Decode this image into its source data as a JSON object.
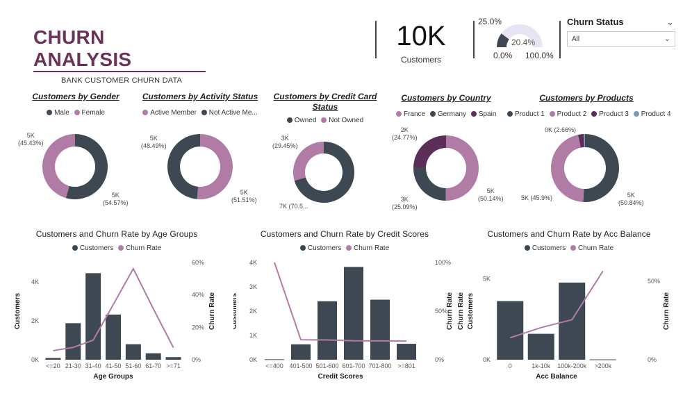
{
  "header": {
    "title": "CHURN ANALYSIS",
    "subtitle": "BANK CUSTOMER CHURN DATA"
  },
  "kpi": {
    "value": "10K",
    "label": "Customers"
  },
  "gauge": {
    "target_label": "25.0%",
    "value_label": "20.4%",
    "min_label": "0.0%",
    "max_label": "100.0%",
    "value": 0.204
  },
  "slicer": {
    "title": "Churn Status",
    "selected": "All"
  },
  "colors": {
    "dark": "#3d4853",
    "purple_light": "#b07ca6",
    "purple_dark": "#5b2e58",
    "blue_light": "#7a9ab5",
    "title": "#6a3358"
  },
  "chart_data": [
    {
      "type": "pie",
      "variant": "donut",
      "title": "Customers by Gender",
      "legend": [
        "Male",
        "Female"
      ],
      "slices": [
        {
          "name": "Male",
          "value": 54.57,
          "label": "5K\n(54.57%)",
          "color": "#3d4853"
        },
        {
          "name": "Female",
          "value": 45.43,
          "label": "5K\n(45.43%)",
          "color": "#b07ca6"
        }
      ]
    },
    {
      "type": "pie",
      "variant": "donut",
      "title": "Customers by Activity Status",
      "legend": [
        "Active Member",
        "Not Active Me..."
      ],
      "slices": [
        {
          "name": "Active Member",
          "value": 51.51,
          "label": "5K\n(51.51%)",
          "color": "#b07ca6"
        },
        {
          "name": "Not Active Member",
          "value": 48.49,
          "label": "5K\n(48.49%)",
          "color": "#3d4853"
        }
      ]
    },
    {
      "type": "pie",
      "variant": "donut",
      "title": "Customers by Credit Card Status",
      "legend": [
        "Owned",
        "Not Owned"
      ],
      "slices": [
        {
          "name": "Owned",
          "value": 70.55,
          "label": "7K (70.5...",
          "color": "#3d4853"
        },
        {
          "name": "Not Owned",
          "value": 29.45,
          "label": "3K\n(29.45%)",
          "color": "#b07ca6"
        }
      ]
    },
    {
      "type": "pie",
      "variant": "donut",
      "title": "Customers by Country",
      "legend": [
        "France",
        "Germany",
        "Spain"
      ],
      "slices": [
        {
          "name": "France",
          "value": 50.14,
          "label": "5K\n(50.14%)",
          "color": "#b07ca6"
        },
        {
          "name": "Spain",
          "value": 25.09,
          "label": "3K\n(25.09%)",
          "color": "#3d4853"
        },
        {
          "name": "Germany",
          "value": 24.77,
          "label": "2K\n(24.77%)",
          "color": "#5b2e58"
        }
      ]
    },
    {
      "type": "pie",
      "variant": "donut",
      "title": "Customers by Products",
      "legend": [
        "Product 1",
        "Product 2",
        "Product 3",
        "Product 4"
      ],
      "slices": [
        {
          "name": "Product 1",
          "value": 50.84,
          "label": "5K\n(50.84%)",
          "color": "#3d4853"
        },
        {
          "name": "Product 2",
          "value": 45.9,
          "label": "5K (45.9%)",
          "color": "#b07ca6"
        },
        {
          "name": "Product 3",
          "value": 2.66,
          "label": "",
          "color": "#5b2e58"
        },
        {
          "name": "Product 4",
          "value": 0.6,
          "label": "0K (2.66%)",
          "color": "#7a9ab5"
        }
      ]
    },
    {
      "type": "bar",
      "combo": "bar+line",
      "title": "Customers and Churn Rate by Age Groups",
      "legend": [
        "Customers",
        "Churn Rate"
      ],
      "categories": [
        "<=20",
        "21-30",
        "31-40",
        "41-50",
        "51-60",
        "61-70",
        ">=71"
      ],
      "series": [
        {
          "name": "Customers",
          "values": [
            89,
            1879,
            4451,
            2320,
            797,
            331,
            133
          ]
        },
        {
          "name": "Churn Rate",
          "values": [
            5.6,
            7.6,
            12.1,
            34.0,
            56.2,
            31.4,
            7.5
          ]
        }
      ],
      "xlabel": "Age Groups",
      "ylabel": "Customers",
      "y2label": "Churn Rate",
      "ylim": [
        0,
        5000
      ],
      "y2lim": [
        0,
        60
      ],
      "yticks": [
        "0K",
        "2K",
        "4K"
      ],
      "y2ticks": [
        "0%",
        "20%",
        "40%",
        "60%"
      ]
    },
    {
      "type": "bar",
      "combo": "bar+line",
      "title": "Customers and Churn Rate by Credit Scores",
      "legend": [
        "Customers",
        "Churn Rate"
      ],
      "categories": [
        "<=400",
        "401-500",
        "501-600",
        "601-700",
        "701-800",
        ">=801"
      ],
      "series": [
        {
          "name": "Customers",
          "values": [
            19,
            633,
            2404,
            3818,
            2471,
            655
          ]
        },
        {
          "name": "Churn Rate",
          "values": [
            100,
            20.5,
            20.4,
            19.5,
            19.4,
            19.2
          ]
        }
      ],
      "xlabel": "Credit Scores",
      "ylabel": "Customers",
      "y2label": "Churn Rate",
      "ylim": [
        0,
        4000
      ],
      "y2lim": [
        0,
        100
      ],
      "yticks": [
        "0K",
        "1K",
        "2K",
        "3K",
        "4K"
      ],
      "y2ticks": [
        "0%",
        "50%",
        "100%"
      ]
    },
    {
      "type": "bar",
      "combo": "bar+line",
      "title": "Customers and Churn Rate by Acc Balance",
      "legend": [
        "Customers",
        "Churn Rate"
      ],
      "categories": [
        "0",
        "1k-10k",
        "100k-200k",
        ">200k"
      ],
      "series": [
        {
          "name": "Customers",
          "values": [
            3617,
            1600,
            4762,
            21
          ]
        },
        {
          "name": "Churn Rate",
          "values": [
            14,
            20.5,
            25.5,
            56.5
          ]
        }
      ],
      "xlabel": "Acc Balance",
      "ylabel": "Customers",
      "y2label": "Churn Rate",
      "ylim": [
        0,
        6000
      ],
      "y2lim": [
        0,
        62
      ],
      "yticks": [
        "0K",
        "5K"
      ],
      "y2ticks": [
        "0%",
        "50%"
      ],
      "extra_left_label": "Churn Rate"
    }
  ]
}
